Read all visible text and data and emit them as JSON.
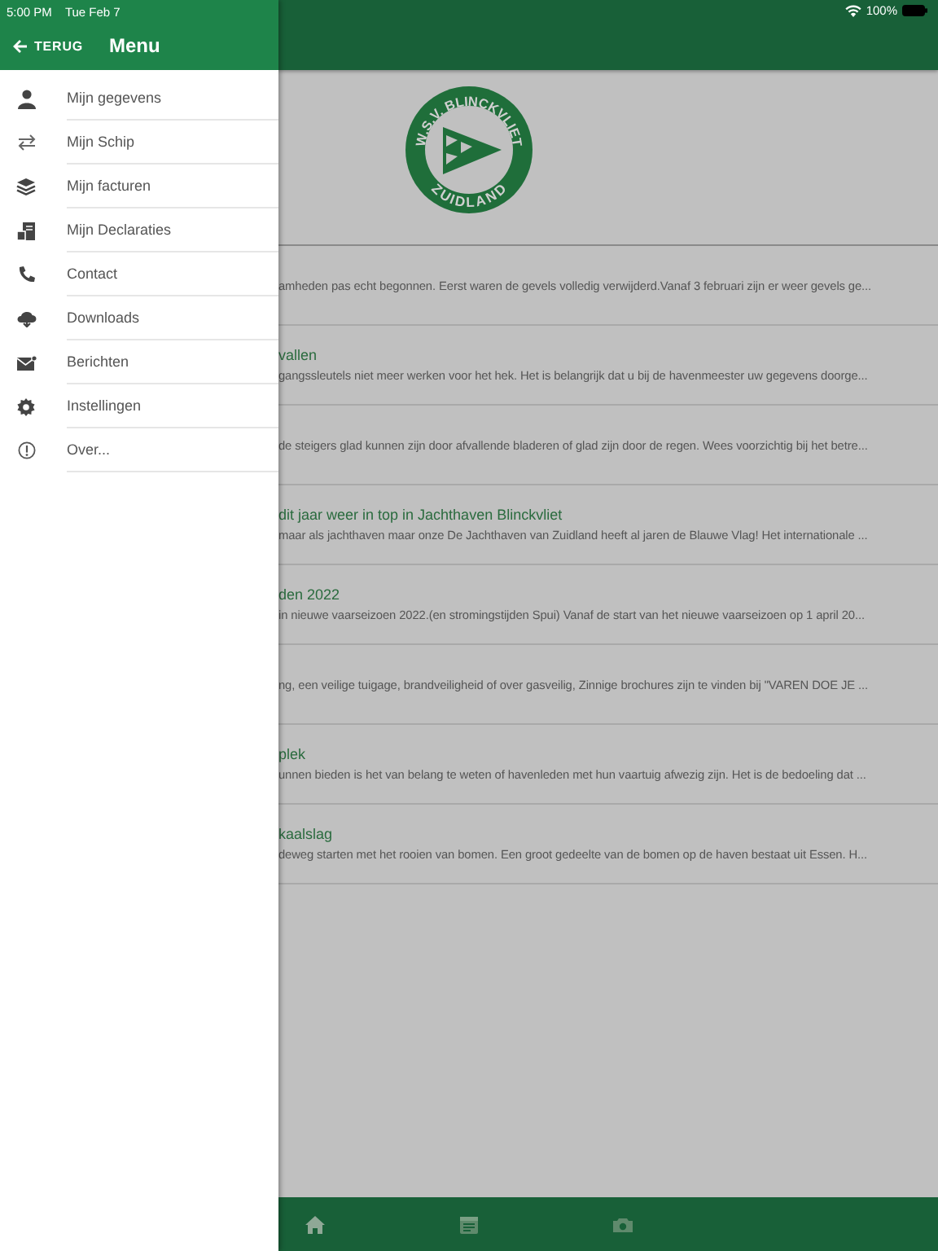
{
  "status_bar": {
    "time": "5:00 PM",
    "date": "Tue Feb 7",
    "battery": "100%"
  },
  "drawer": {
    "back_label": "TERUG",
    "title": "Menu",
    "items": [
      {
        "kind": "person",
        "label": "Mijn gegevens"
      },
      {
        "kind": "swap",
        "label": "Mijn Schip"
      },
      {
        "kind": "layers",
        "label": "Mijn facturen"
      },
      {
        "kind": "document",
        "label": "Mijn Declaraties"
      },
      {
        "kind": "phone",
        "label": "Contact"
      },
      {
        "kind": "download",
        "label": "Downloads"
      },
      {
        "kind": "mail",
        "label": "Berichten"
      },
      {
        "kind": "gear",
        "label": "Instellingen"
      },
      {
        "kind": "info",
        "label": "Over..."
      }
    ]
  },
  "logo": {
    "top_text": "W.S.V. BLINCKVLIET",
    "bottom_text": "ZUIDLAND"
  },
  "news": [
    {
      "text": "amheden pas echt begonnen. Eerst waren de gevels volledig verwijderd.Vanaf 3 februari zijn er weer gevels ge..."
    },
    {
      "title": "vallen",
      "text": "gangssleutels niet meer werken voor het hek. Het is belangrijk dat u bij de havenmeester uw gegevens doorge..."
    },
    {
      "text": "de steigers glad kunnen zijn door afvallende bladeren of glad zijn door de regen. Wees voorzichtig bij het betre..."
    },
    {
      "title": "dit jaar weer in top in Jachthaven Blinckvliet",
      "text": "maar als jachthaven maar onze De Jachthaven van Zuidland heeft al jaren de Blauwe Vlag! Het internationale ..."
    },
    {
      "title": "den 2022",
      "text": "in nieuwe vaarseizoen 2022.(en stromingstijden Spui) Vanaf de start van het nieuwe vaarseizoen op 1 april 20..."
    },
    {
      "text": "ng, een veilige tuigage, brandveiligheid of over gasveilig,  Zinnige brochures zijn te vinden bij \"VAREN DOE JE ..."
    },
    {
      "title": "plek",
      "text": "unnen bieden is het van belang te weten of havenleden met hun vaartuig afwezig zijn. Het is de bedoeling dat ..."
    },
    {
      "title": "kaalslag",
      "text": "deweg starten met het rooien van bomen. Een groot gedeelte van de bomen op de haven bestaat uit Essen. H..."
    }
  ],
  "tab_bar": [
    {
      "kind": "home"
    },
    {
      "kind": "calendar"
    },
    {
      "kind": "camera"
    }
  ]
}
